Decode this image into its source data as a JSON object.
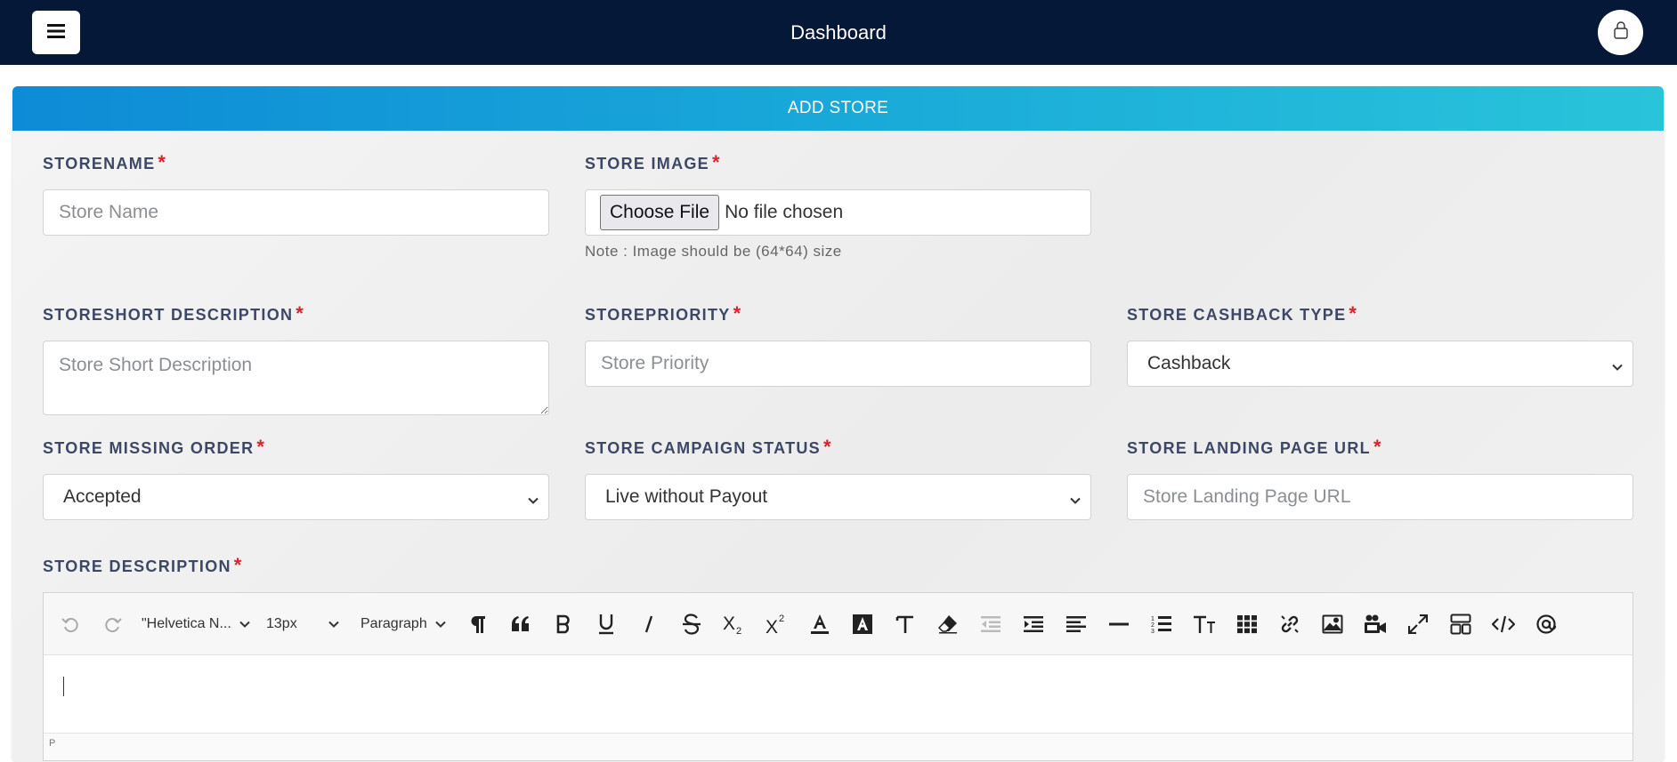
{
  "header": {
    "title": "Dashboard"
  },
  "card": {
    "title": "ADD STORE"
  },
  "form": {
    "required_mark": "*",
    "store_name": {
      "label": "STORENAME",
      "placeholder": "Store Name"
    },
    "store_image": {
      "label": "STORE IMAGE",
      "button": "Choose File",
      "status": "No file chosen",
      "note": "Note : Image should be (64*64) size"
    },
    "short_description": {
      "label": "STORESHORT DESCRIPTION",
      "placeholder": "Store Short Description"
    },
    "priority": {
      "label": "STOREPRIORITY",
      "placeholder": "Store Priority"
    },
    "cashback_type": {
      "label": "STORE CASHBACK TYPE",
      "value": "Cashback"
    },
    "missing_order": {
      "label": "STORE MISSING ORDER",
      "value": "Accepted"
    },
    "campaign_status": {
      "label": "STORE CAMPAIGN STATUS",
      "value": "Live without Payout"
    },
    "landing_url": {
      "label": "STORE LANDING PAGE URL",
      "placeholder": "Store Landing Page URL"
    },
    "description": {
      "label": "STORE DESCRIPTION"
    }
  },
  "editor": {
    "font_family": "\"Helvetica N...",
    "font_size": "13px",
    "block_format": "Paragraph",
    "status_path": "P",
    "icons": [
      "undo-icon",
      "redo-icon",
      "paragraph-icon",
      "blockquote-icon",
      "bold-icon",
      "underline-icon",
      "italic-icon",
      "strikethrough-icon",
      "subscript-icon",
      "superscript-icon",
      "font-color-icon",
      "highlight-color-icon",
      "clear-format-icon",
      "eraser-icon",
      "outdent-icon",
      "indent-icon",
      "align-left-icon",
      "horizontal-rule-icon",
      "ordered-list-icon",
      "line-height-icon",
      "table-icon",
      "link-icon",
      "image-icon",
      "video-icon",
      "fullscreen-icon",
      "template-icon",
      "code-view-icon",
      "mention-icon"
    ]
  }
}
